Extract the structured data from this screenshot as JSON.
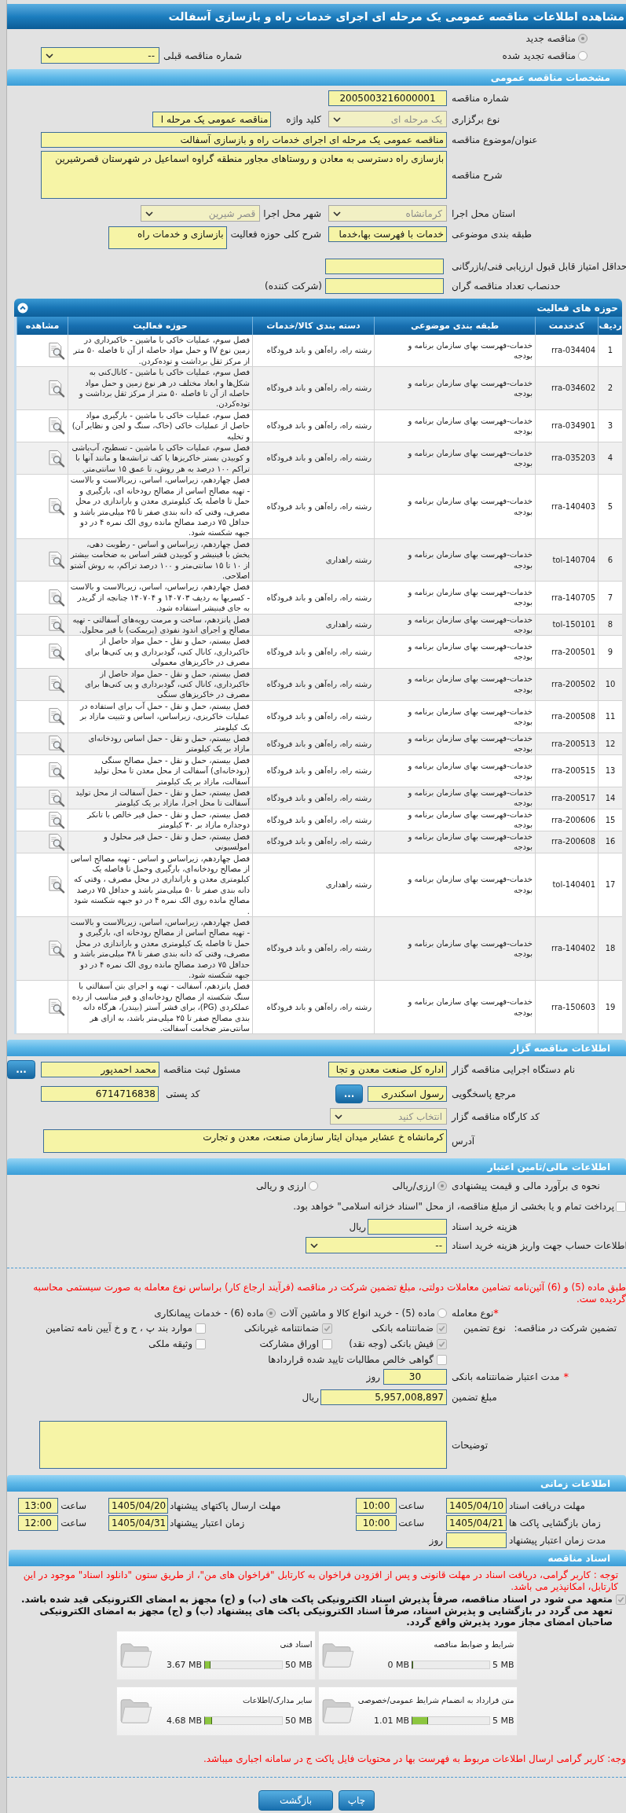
{
  "window": {
    "title": "مشاهده اطلاعات مناقصه عمومی یک مرحله ای اجرای خدمات راه و بازسازی آسفالت"
  },
  "tender_kind": [
    {
      "label": "مناقصه جدید",
      "selected": true
    },
    {
      "label": "مناقصه تجدید شده",
      "selected": false
    }
  ],
  "previous_tender": {
    "label": "شماره مناقصه قبلی",
    "value": "--",
    "disabled": false
  },
  "general": {
    "header": "مشخصات مناقصه عمومی",
    "tender_number": {
      "label": "شماره مناقصه",
      "value": "2005003216000001"
    },
    "holding_type": {
      "label": "نوع برگزاری",
      "value": "یک مرحله ای",
      "disabled": true
    },
    "keyword": {
      "label": "کلید واژه",
      "value": "مناقصه عمومی یک مرحله ا"
    },
    "subject": {
      "label": "عنوان/موضوع مناقصه",
      "value": "مناقصه عمومی یک مرحله ای اجرای خدمات راه و بازسازی آسفالت"
    },
    "description": {
      "label": "شرح مناقصه",
      "value": "بازسازی راه دسترسی به معادن و روستاهای مجاور منطقه گراوه اسماعیل در شهرستان قصرشیرین"
    },
    "province": {
      "label": "استان محل اجرا",
      "value": "کرمانشاه",
      "disabled": true
    },
    "city": {
      "label": "شهر محل اجرا",
      "value": "قصر شیرین",
      "disabled": true
    },
    "classification": {
      "label": "طبقه بندی موضوعی",
      "value": "خدمات با فهرست بها،خدما"
    },
    "activity_summary": {
      "label": "شرح کلی حوزه فعالیت",
      "value": "بازسازی و خدمات راه"
    },
    "min_score": {
      "label": "حداقل امتیاز قابل قبول ارزیابی فنی/بازرگانی"
    },
    "min_bidders": {
      "label": "حدنصاب تعداد مناقصه گران",
      "suffix": "(شرکت کننده)"
    }
  },
  "activities": {
    "header": "حوزه های فعالیت",
    "expanded": true,
    "columns": [
      "ردیف",
      "کدخدمت",
      "طبقه بندی موضوعی",
      "دسته بندی کالا/خدمات",
      "حوزه فعالیت",
      "مشاهده"
    ],
    "rows": [
      {
        "index": "1",
        "code": "rra-034404",
        "classification": "خدمات-فهرست بهای سازمان برنامه و بودجه",
        "category": "رشته راه، راه‌آهن و باند فرودگاه",
        "activity": "فصل سوم، عملیات خاکی با ماشین - خاکبرداری در زمین نوع IV و حمل مواد حاصله از آن تا فاصله ۵۰ متر از مرکز ثقل برداشت و توده‌کردن."
      },
      {
        "index": "2",
        "code": "rra-034602",
        "classification": "خدمات-فهرست بهای سازمان برنامه و بودجه",
        "category": "رشته راه، راه‌آهن و باند فرودگاه",
        "activity": "فصل سوم، عملیات خاکی با ماشین - کانال‌کنی به شکل‌ها و ابعاد مختلف در هر نوع زمین و حمل مواد حاصله از آن تا فاصله ۵۰ متر از مرکز ثقل برداشت و توده‌کردن."
      },
      {
        "index": "3",
        "code": "rra-034901",
        "classification": "خدمات-فهرست بهای سازمان برنامه و بودجه",
        "category": "رشته راه، راه‌آهن و باند فرودگاه",
        "activity": "فصل سوم، عملیات خاکی با ماشین - بارگیری مواد حاصل از عملیات خاکی (خاک، سنگ و لجن و نظایر آن) و تخلیه"
      },
      {
        "index": "4",
        "code": "rra-035203",
        "classification": "خدمات-فهرست بهای سازمان برنامه و بودجه",
        "category": "رشته راه، راه‌آهن و باند فرودگاه",
        "activity": "فصل سوم، عملیات خاکی با ماشین - تسطیح، آب‌پاشی و کوبیدن بستر خاکریزها یا کف ترانشه‌ها و مانند آنها با تراکم ۱۰۰ درصد به هر روش، تا عمق ۱۵ سانتی‌متر."
      },
      {
        "index": "5",
        "code": "rra-140403",
        "classification": "خدمات-فهرست بهای سازمان برنامه و بودجه",
        "category": "رشته راه، راه‌آهن و باند فرودگاه",
        "activity": "فصل چهاردهم، زیراساس، اساس، زیربالاست و بالاست - تهیه مصالح اساس از مصالح رودخانه ای، بارگیری و حمل تا فاصله یک کیلومتری معدن و باراندازی در محل مصرف، وقتی که دانه بندی صفر تا ۲۵ میلی‌متر باشد و حداقل ۷۵ درصد مصالح مانده روی الک نمره ۴ در دو جبهه شکسته شود."
      },
      {
        "index": "6",
        "code": "tol-140704",
        "classification": "خدمات-فهرست بهای سازمان برنامه و بودجه",
        "category": "رشته راهداری",
        "activity": "فصل چهاردهم، زیراساس و اساس - رطوبت دهی، پخش با فینیشر و کوبیدن قشر اساس به ضخامت بیشتر از ۱۰ تا ۱۵ سانتی‌متر و ۱۰۰ درصد تراکم، به روش آشتو اصلاحی."
      },
      {
        "index": "7",
        "code": "rra-140705",
        "classification": "خدمات-فهرست بهای سازمان برنامه و بودجه",
        "category": "رشته راه، راه‌آهن و باند فرودگاه",
        "activity": "فصل چهاردهم، زیراساس، اساس، زیربالاست و بالاست - کسربها به ردیف ۱۴۰۷۰۳ و ۱۴۰۷۰۴ چنانچه از گریدر به جای فینیشر استفاده شود."
      },
      {
        "index": "8",
        "code": "tol-150101",
        "classification": "خدمات-فهرست بهای سازمان برنامه و بودجه",
        "category": "رشته راهداری",
        "activity": "فصل پانزدهم، ساخت و مرمت رویه‌های آسفالتی - تهیه مصالح و اجرای اندود نفوذی (پریمکت) با قیر محلول."
      },
      {
        "index": "9",
        "code": "rra-200501",
        "classification": "خدمات-فهرست بهای سازمان برنامه و بودجه",
        "category": "رشته راه، راه‌آهن و باند فرودگاه",
        "activity": "فصل بیستم، حمل و نقل - حمل مواد حاصل از خاکبرداری، کانال کنی، گودبرداری و پی کنی‌ها برای مصرف در خاکریزهای معمولی"
      },
      {
        "index": "10",
        "code": "rra-200502",
        "classification": "خدمات-فهرست بهای سازمان برنامه و بودجه",
        "category": "رشته راه، راه‌آهن و باند فرودگاه",
        "activity": "فصل بیستم، حمل و نقل - حمل مواد حاصل از خاکبرداری، کانال کنی، گودبرداری و پی کنی‌ها برای مصرف در خاکریزهای سنگی"
      },
      {
        "index": "11",
        "code": "rra-200508",
        "classification": "خدمات-فهرست بهای سازمان برنامه و بودجه",
        "category": "رشته راه، راه‌آهن و باند فرودگاه",
        "activity": "فصل بیستم، حمل و نقل - حمل آب برای استفاده در عملیات خاکریزی، زیراساس، اساس و تثبیت مازاد بر یک کیلومتر"
      },
      {
        "index": "12",
        "code": "rra-200513",
        "classification": "خدمات-فهرست بهای سازمان برنامه و بودجه",
        "category": "رشته راه، راه‌آهن و باند فرودگاه",
        "activity": "فصل بیستم، حمل و نقل - حمل اساس رودخانه‌ای مازاد بر یک کیلومتر"
      },
      {
        "index": "13",
        "code": "rra-200515",
        "classification": "خدمات-فهرست بهای سازمان برنامه و بودجه",
        "category": "رشته راه، راه‌آهن و باند فرودگاه",
        "activity": "فصل بیستم، حمل و نقل - حمل مصالح سنگی (رودخانه‌ای) آسفالت از محل معدن تا محل تولید آسفالت، مازاد بر یک کیلومتر"
      },
      {
        "index": "14",
        "code": "rra-200517",
        "classification": "خدمات-فهرست بهای سازمان برنامه و بودجه",
        "category": "رشته راه، راه‌آهن و باند فرودگاه",
        "activity": "فصل بیستم، حمل و نقل - حمل آسفالت از محل تولید آسفالت تا محل اجرا، مازاد بر یک کیلومتر"
      },
      {
        "index": "15",
        "code": "rra-200606",
        "classification": "خدمات-فهرست بهای سازمان برنامه و بودجه",
        "category": "رشته راه، راه‌آهن و باند فرودگاه",
        "activity": "فصل بیستم، حمل و نقل - حمل قیر خالص با تانکر دوجداره مازاد بر ۳۰ کیلومتر"
      },
      {
        "index": "16",
        "code": "rra-200608",
        "classification": "خدمات-فهرست بهای سازمان برنامه و بودجه",
        "category": "رشته راه، راه‌آهن و باند فرودگاه",
        "activity": "فصل بیستم، حمل و نقل - حمل قیر محلول و امولسیونی"
      },
      {
        "index": "17",
        "code": "tol-140401",
        "classification": "خدمات-فهرست بهای سازمان برنامه و بودجه",
        "category": "رشته راهداری",
        "activity": "فصل چهاردهم، زیراساس و اساس - تهیه مصالح اساس از مصالح رودخانه‌ای، بارگیری وحمل تا فاصله یک کیلومتری معدن و باراندازی در محل مصرف ، وقتی که دانه بندی صفر تا ۵۰ میلی‌متر باشد و حداقل ۷۵ درصد مصالح مانده روی الک نمره ۴ در دو جبهه شکسته شود ."
      },
      {
        "index": "18",
        "code": "rra-140402",
        "classification": "خدمات-فهرست بهای سازمان برنامه و بودجه",
        "category": "رشته راه، راه‌آهن و باند فرودگاه",
        "activity": "فصل چهاردهم، زیراساس، اساس، زیربالاست و بالاست - تهیه مصالح اساس از مصالح رودخانه ای، بارگیری و حمل تا فاصله یک کیلومتری معدن و باراندازی در محل مصرف، وقتی که دانه بندی صفر تا ۳۸ میلی‌متر باشد و حداقل ۷۵ درصد مصالح مانده روی الک نمره ۴ در دو جبهه شکسته شود."
      },
      {
        "index": "19",
        "code": "rra-150603",
        "classification": "خدمات-فهرست بهای سازمان برنامه و بودجه",
        "category": "رشته راه، راه‌آهن و باند فرودگاه",
        "activity": "فصل پانزدهم، آسفالت - تهیه و اجرای بتن آسفالتی با سنگ شکسته از مصالح رودخانه‌ای و قیر مناسب از رده عملکردی (PG)، برای قشر آستر (بیندر)، هرگاه دانه بندی مصالح صفر تا ۲۵ میلی‌متر باشد، به ازای هر سانتی‌متر ضخامت آسفالت."
      }
    ]
  },
  "organizer": {
    "header": "اطلاعات مناقصه گزار",
    "agency": {
      "label": "نام دستگاه اجرایی مناقصه گزار",
      "value": "اداره کل صنعت معدن و تجا"
    },
    "registrar": {
      "label": "مسئول ثبت مناقصه",
      "value": "محمد احمدپور",
      "button": "..."
    },
    "responder": {
      "label": "مرجع پاسخگویی",
      "value": "رسول اسکندری",
      "button": "..."
    },
    "postal_code": {
      "label": "کد پستی",
      "value": "6714716838"
    },
    "workshop_code": {
      "label": "کد کارگاه مناقصه گزار",
      "value": "انتخاب کنید",
      "disabled": true
    },
    "address": {
      "label": "آدرس",
      "value": "کرمانشاه خ عشایر میدان ایثار سازمان صنعت، معدن و تجارت"
    }
  },
  "financial": {
    "header": "اطلاعات مالی/تامین اعتبار",
    "estimate": {
      "label": "نحوه ی برآورد مالی و قیمت پیشنهادی",
      "options": [
        {
          "label": "ارزی/ریالی",
          "selected": true
        },
        {
          "label": "ارزی و ریالی",
          "selected": false
        }
      ]
    },
    "treasury": {
      "label": "پرداخت تمام و یا بخشی از مبلغ مناقصه، از محل \"اسناد خزانه اسلامی\" خواهد بود.",
      "checked": false
    },
    "document_fee": {
      "label": "هزینه خرید اسناد",
      "unit": "ریال"
    },
    "account": {
      "label": "اطلاعات حساب جهت واریز هزینه خرید اسناد",
      "value": "--",
      "disabled": false
    },
    "notice": "طبق ماده (5) و (6) آئین‌نامه تضامین معاملات دولتی، مبلغ تضمین شرکت در مناقصه (فرآیند ارجاع کار) براساس نوع معامله به صورت سیستمی محاسبه گردیده ست.",
    "deal_type": {
      "mark": "*",
      "label": "نوع معامله",
      "options": [
        {
          "label": "ماده (5) - خرید انواع کالا و ماشین آلات",
          "selected": false
        },
        {
          "label": "ماده (6) - خدمات پیمانکاری",
          "selected": true
        }
      ]
    },
    "guarantee": {
      "label": "تضمین شرکت در مناقصه:",
      "type_label": "نوع تضمین",
      "options": [
        {
          "label": "ضمانتنامه بانکی",
          "checked": true
        },
        {
          "label": "ضمانتنامه غیربانکی",
          "checked": true
        },
        {
          "label": "موارد بند پ ، ح و خ آیین نامه تضامین",
          "checked": false
        },
        {
          "label": "فیش بانکی (وجه نقد)",
          "checked": true
        },
        {
          "label": "اوراق مشارکت",
          "checked": false
        },
        {
          "label": "وثیقه ملکی",
          "checked": false
        },
        {
          "label": "گواهی خالص مطالبات تایید شده قراردادها",
          "checked": false
        }
      ]
    },
    "validity": {
      "mark": "*",
      "label": "مدت اعتبار ضمانتنامه بانکی",
      "value": "30",
      "unit": "روز"
    },
    "amount": {
      "label": "مبلغ تضمین",
      "value": "5,957,008,897",
      "unit": "ریال"
    },
    "notes": {
      "label": "توضیحات"
    }
  },
  "timing": {
    "header": "اطلاعات زمانی",
    "deadlines": [
      {
        "label": "مهلت دریافت اسناد",
        "date": "1405/04/10",
        "time_label": "ساعت",
        "time": "10:00"
      },
      {
        "label": "مهلت ارسال پاکتهای پیشنهاد",
        "date": "1405/04/20",
        "time_label": "ساعت",
        "time": "13:00"
      },
      {
        "label": "زمان بازگشایی پاکت ها",
        "date": "1405/04/21",
        "time_label": "ساعت",
        "time": "10:00"
      },
      {
        "label": "زمان اعتبار پیشنهاد",
        "date": "1405/04/31",
        "time_label": "ساعت",
        "time": "12:00"
      }
    ],
    "validity_duration": {
      "label": "مدت زمان اعتبار پیشنهاد",
      "unit": "روز"
    }
  },
  "documents": {
    "header": "اسناد مناقصه",
    "notice": "توجه : کاربر گرامی، دریافت اسناد در مهلت قانونی و پس از افزودن فراخوان به کارتابل \"فراخوان های من\"، از طریق ستون \"دانلود اسناد\" موجود در این کارتابل، امکانپذیر می باشد.",
    "commitment": {
      "text": "متعهد می شود در اسناد مناقصه، صرفاً پذیرش اسناد الکترونیکی پاکت های (ب) و (ج) مجهز به امضای الکترونیکی قید شده باشد. تعهد می گردد در بازگشایی و پذیرش اسناد، صرفاً اسناد الکترونیکی پاکت های پیشنهاد (ب) و (ج) مجهز به امضای الکترونیکی صاحبان امضای مجاز مورد پذیرش واقع گردد.",
      "checked": true
    },
    "files": [
      {
        "title": "شرایط و ضوابط مناقصه",
        "max": "5 MB",
        "used": "0 MB",
        "level": 0
      },
      {
        "title": "اسناد فنی",
        "max": "50 MB",
        "used": "3.67 MB",
        "level": 0.0734
      },
      {
        "title": "متن قرارداد به انضمام شرایط عمومی/خصوصی",
        "max": "5 MB",
        "used": "1.01 MB",
        "level": 0.202
      },
      {
        "title": "سایر مدارک/اطلاعات",
        "max": "50 MB",
        "used": "4.68 MB",
        "level": 0.0936
      }
    ],
    "footer_notice": "وجه: کاربر گرامی ارسال اطلاعات مربوط به فهرست بها در محتویات فایل پاکت ج در سامانه اجباری میباشد."
  },
  "buttons": [
    {
      "label": "چاپ"
    },
    {
      "label": "بازگشت"
    }
  ]
}
